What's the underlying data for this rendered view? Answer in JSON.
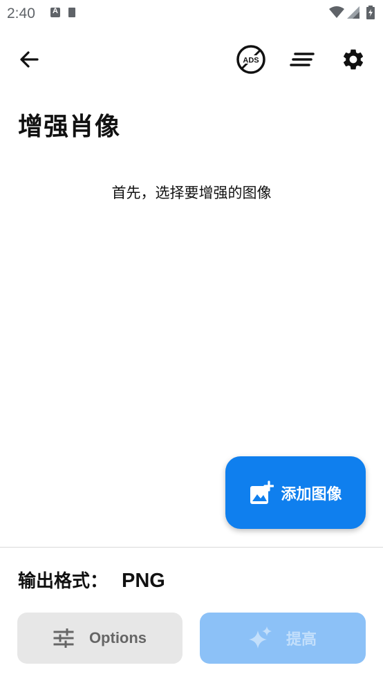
{
  "status_bar": {
    "time": "2:40"
  },
  "toolbar": {
    "back_icon": "arrow-back-icon",
    "ads_icon": "remove-ads-icon",
    "sort_icon": "sort-lines-icon",
    "settings_icon": "gear-icon"
  },
  "page": {
    "title": "增强肖像",
    "hint": "首先，选择要增强的图像"
  },
  "fab": {
    "label": "添加图像",
    "icon": "add-photo-icon"
  },
  "output": {
    "label": "输出格式：",
    "value": "PNG"
  },
  "actions": {
    "options_label": "Options",
    "options_icon": "tune-sliders-icon",
    "enhance_label": "提高",
    "enhance_icon": "sparkles-icon",
    "enhance_enabled": false
  },
  "colors": {
    "accent": "#0f7fee",
    "accent_disabled": "#8cc1f7",
    "secondary_button": "#e7e7e7"
  }
}
